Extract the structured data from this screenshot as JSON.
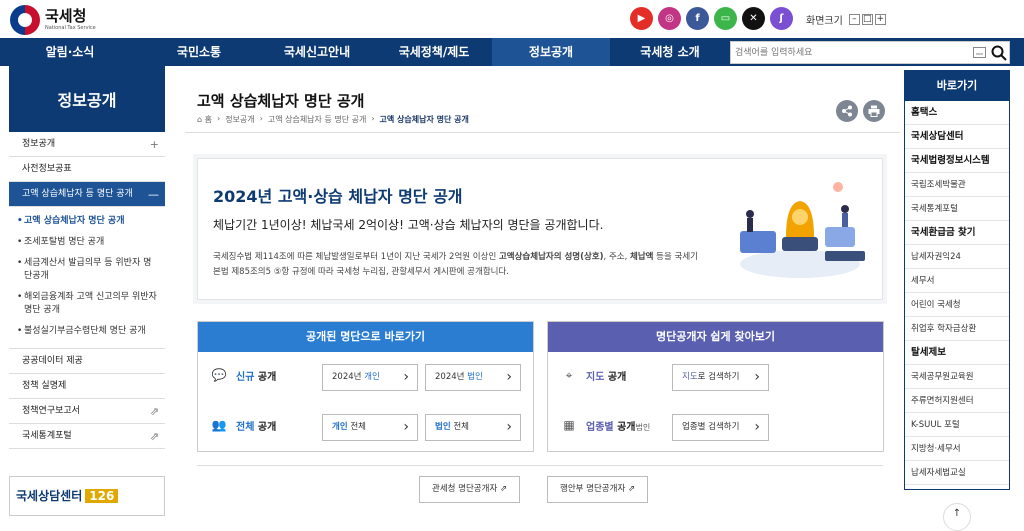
{
  "header": {
    "logo_ko": "국세청",
    "logo_en": "National Tax Service",
    "zoom_label": "화면크기",
    "zoom_minus": "–",
    "zoom_reset": "□",
    "zoom_plus": "+"
  },
  "sns": [
    {
      "name": "youtube-icon",
      "glyph": "▶",
      "color": "#e52d27"
    },
    {
      "name": "instagram-icon",
      "glyph": "◎",
      "color": "#c13584"
    },
    {
      "name": "facebook-icon",
      "glyph": "f",
      "color": "#3b5998"
    },
    {
      "name": "talk-icon",
      "glyph": "▭",
      "color": "#3cb64a"
    },
    {
      "name": "x-icon",
      "glyph": "✕",
      "color": "#111111"
    },
    {
      "name": "kakao-story-icon",
      "glyph": "ʃ",
      "color": "#7b4fd1"
    }
  ],
  "gnb": {
    "items": [
      "알림·소식",
      "국민소통",
      "국세신고안내",
      "국세정책/제도",
      "정보공개",
      "국세청 소개"
    ],
    "search_placeholder": "검색어를 입력하세요"
  },
  "lnb": {
    "title": "정보공개",
    "items": {
      "info": "정보공개",
      "pre": "사전정보공표",
      "high": "고액 상습체납자 등 명단 공개",
      "sub": [
        "고액 상습체납자 명단 공개",
        "조세포탈범 명단 공개",
        "세금계산서 발급의무 등 위반자 명단공개",
        "해외금융계좌 고액 신고의무 위반자 명단 공개",
        "불성실기부금수령단체 명단 공개"
      ],
      "open_data": "공공데이터 제공",
      "policy": "정책 실명제",
      "research": "정책연구보고서",
      "stats": "국세통계포털"
    },
    "plus": "+",
    "minus": "—",
    "link": "⇗",
    "callcenter": "국세상담센터",
    "callnum": "126"
  },
  "content": {
    "title": "고액 상습체납자 명단 공개",
    "breadcrumb": [
      "⌂ 홈",
      "정보공개",
      "고액 상습체납자 등 명단 공개",
      "고액 상습체납자 명단 공개"
    ],
    "hero_title": "2024년 고액·상습 체납자 명단 공개",
    "hero_lead": "체납기간 1년이상! 체납국세 2억이상! 고액·상습 체납자의 명단을 공개합니다.",
    "hero_desc_1": "국세징수법 제114조에 따른 체납발생일로부터 1년이 지난 국세가 2억원 이상인 ",
    "hero_desc_bold1": "고액상습체납자의 성명(상호)",
    "hero_desc_2": ", 주소, ",
    "hero_desc_bold2": "체납액",
    "hero_desc_3": " 등을 국세기본법 제85조의5 ⑤항 규정에 따라 국세청 누리집, 관할세무서 게시판에 공개합니다."
  },
  "panel_left": {
    "header": "공개된 명단으로 바로가기",
    "color": "#2a7dd1",
    "row1_label_hl": "신규",
    "row1_label": " 공개",
    "row1_btn1_a": "2024년 ",
    "row1_btn1_b": "개인",
    "row1_btn2_a": "2024년 ",
    "row1_btn2_b": "법인",
    "row2_label_hl": "전체",
    "row2_label": " 공개",
    "row2_btn1_a": "개인",
    "row2_btn1_b": " 전체",
    "row2_btn2_a": "법인",
    "row2_btn2_b": " 전체"
  },
  "panel_right": {
    "header": "명단공개자 쉽게 찾아보기",
    "color": "#5a5fb0",
    "row1_label_hl": "지도",
    "row1_label": " 공개",
    "row1_btn_a": "지도",
    "row1_btn_b": "로 검색하기",
    "row2_label_hl": "업종별",
    "row2_label": " 공개",
    "row2_label_small": "법인",
    "row2_btn": "업종별 검색하기"
  },
  "links": {
    "customs": "관세청 명단공개자",
    "mois": "행안부 명단공개자",
    "ext": "⇗"
  },
  "quick": {
    "title": "바로가기",
    "items": [
      {
        "t": "홈택스",
        "b": true
      },
      {
        "t": "국세상담센터",
        "b": true
      },
      {
        "t": "국세법령정보시스템",
        "b": true
      },
      {
        "t": "국립조세박물관",
        "b": false
      },
      {
        "t": "국세통계포털",
        "b": false
      },
      {
        "t": "국세환급금 찾기",
        "b": true
      },
      {
        "t": "납세자권익24",
        "b": false
      },
      {
        "t": "세무서",
        "b": false
      },
      {
        "t": "어린이 국세청",
        "b": false
      },
      {
        "t": "취업후 학자금상환",
        "b": false
      },
      {
        "t": "탈세제보",
        "b": true
      },
      {
        "t": "국세공무원교육원",
        "b": false
      },
      {
        "t": "주류면허지원센터",
        "b": false
      },
      {
        "t": "K-SUUL 포털",
        "b": false
      },
      {
        "t": "지방청·세무서",
        "b": false
      },
      {
        "t": "납세자세법교실",
        "b": false
      }
    ]
  },
  "top_button": "↑"
}
